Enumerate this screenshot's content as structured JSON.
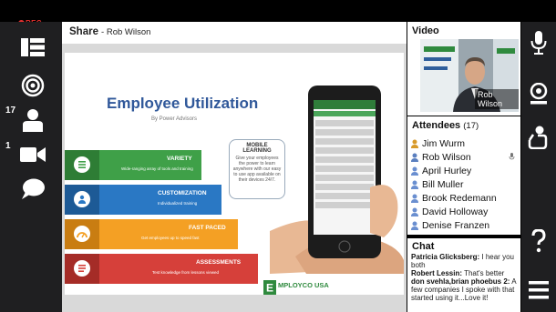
{
  "recording": {
    "label": "REC"
  },
  "sidebar_left": {
    "attendee_count_badge": "17",
    "camera_count_badge": "1"
  },
  "share": {
    "title": "Share",
    "presenter": "Rob Wilson"
  },
  "slide": {
    "title": "Employee Utilization",
    "subtitle": "By Power Advisors",
    "bars": [
      {
        "title": "VARIETY",
        "desc": "Wide-ranging array of tools and training"
      },
      {
        "title": "CUSTOMIZATION",
        "desc": "Individualized training"
      },
      {
        "title": "FAST PACED",
        "desc": "Get employees up to speed fast"
      },
      {
        "title": "ASSESSMENTS",
        "desc": "Test knowledge from lessons viewed"
      }
    ],
    "mobile_learning": {
      "title": "MOBILE LEARNING",
      "text": "Give your employees the power to learn anywhere with our easy to use app available on their devices 24/7."
    },
    "logo_text": "MPLOYCO USA"
  },
  "video": {
    "title": "Video",
    "name": "Rob Wilson"
  },
  "attendees": {
    "title": "Attendees",
    "count": "(17)",
    "items": [
      {
        "name": "Jim Wurm",
        "role": "host"
      },
      {
        "name": "Rob Wilson",
        "role": "presenter"
      },
      {
        "name": "April Hurley",
        "role": "attendee"
      },
      {
        "name": "Bill Muller",
        "role": "attendee"
      },
      {
        "name": "Brook Redemann",
        "role": "attendee"
      },
      {
        "name": "David Holloway",
        "role": "attendee"
      },
      {
        "name": "Denise Franzen",
        "role": "attendee"
      }
    ]
  },
  "chat": {
    "title": "Chat",
    "messages": [
      {
        "sender": "Patricia Glicksberg:",
        "text": "I hear you both"
      },
      {
        "sender": "Robert Lessin:",
        "text": "That's better"
      },
      {
        "sender": "don svehla,brian phoebus 2:",
        "text": "A few companies I spoke with that started using it...Love it!"
      }
    ]
  },
  "colors": {
    "sidebar": "#1f1f21",
    "rec": "#e8302f",
    "slide_title": "#30589a",
    "bar_green": "#3fa048",
    "bar_blue": "#2a78c4",
    "bar_orange": "#f4a024",
    "bar_red": "#d6403a"
  },
  "icons": {
    "left": [
      "layout-icon",
      "broadcast-icon",
      "person-icon",
      "camera-icon",
      "chat-bubble-icon"
    ],
    "right": [
      "microphone-icon",
      "webcam-icon",
      "raise-hand-icon",
      "help-icon",
      "menu-icon"
    ]
  }
}
